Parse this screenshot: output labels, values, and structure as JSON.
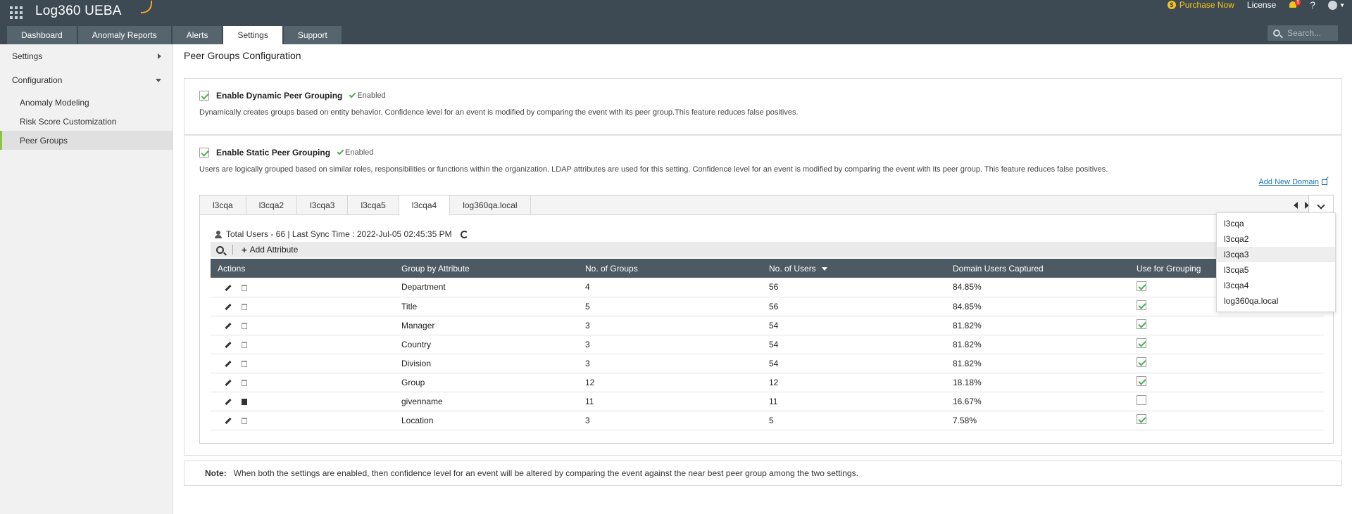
{
  "app": {
    "logo_text": "Log360 UEBA",
    "purchase_label": "Purchase Now",
    "license_label": "License",
    "alert_count": "5",
    "help_label": "?"
  },
  "nav": {
    "tabs": [
      {
        "label": "Dashboard"
      },
      {
        "label": "Anomaly Reports"
      },
      {
        "label": "Alerts"
      },
      {
        "label": "Settings"
      },
      {
        "label": "Support"
      }
    ],
    "active_tab": "Settings",
    "search_placeholder": "Search..."
  },
  "sidebar": {
    "settings_label": "Settings",
    "configuration_label": "Configuration",
    "items": [
      {
        "label": "Anomaly Modeling"
      },
      {
        "label": "Risk Score Customization"
      },
      {
        "label": "Peer Groups"
      }
    ],
    "active_item": "Peer Groups"
  },
  "page": {
    "title": "Peer Groups Configuration",
    "dynamic": {
      "label": "Enable Dynamic Peer Grouping",
      "status": "Enabled",
      "description": "Dynamically creates groups based on entity behavior. Confidence level for an event is modified by comparing the event with its peer group.This feature reduces false positives."
    },
    "static": {
      "label": "Enable Static Peer Grouping",
      "status": "Enabled",
      "description": "Users are logically grouped based on similar roles, responsibilities or functions within the organization. LDAP attributes are used for this setting. Confidence level for an event is modified by comparing the event with its peer group. This feature reduces false positives."
    },
    "add_domain_label": "Add New Domain",
    "domain_tabs": [
      "l3cqa",
      "l3cqa2",
      "l3cqa3",
      "l3cqa5",
      "l3cqa4",
      "log360qa.local"
    ],
    "active_domain": "l3cqa4",
    "sync_info": "Total Users - 66 | Last Sync Time : 2022-Jul-05 02:45:35 PM",
    "add_attribute_label": "Add Attribute",
    "table": {
      "headers": {
        "actions": "Actions",
        "group_by": "Group by Attribute",
        "num_groups": "No. of Groups",
        "num_users": "No. of Users",
        "domain_captured": "Domain Users Captured",
        "use_for_grouping": "Use for Grouping"
      },
      "rows": [
        {
          "attribute": "Department",
          "groups": "4",
          "users": "56",
          "captured": "84.85%",
          "use": true
        },
        {
          "attribute": "Title",
          "groups": "5",
          "users": "56",
          "captured": "84.85%",
          "use": true
        },
        {
          "attribute": "Manager",
          "groups": "3",
          "users": "54",
          "captured": "81.82%",
          "use": true
        },
        {
          "attribute": "Country",
          "groups": "3",
          "users": "54",
          "captured": "81.82%",
          "use": true
        },
        {
          "attribute": "Division",
          "groups": "3",
          "users": "54",
          "captured": "81.82%",
          "use": true
        },
        {
          "attribute": "Group",
          "groups": "12",
          "users": "12",
          "captured": "18.18%",
          "use": true
        },
        {
          "attribute": "givenname",
          "groups": "11",
          "users": "11",
          "captured": "16.67%",
          "use": false
        },
        {
          "attribute": "Location",
          "groups": "3",
          "users": "5",
          "captured": "7.58%",
          "use": true
        }
      ]
    },
    "domain_dropdown": [
      "l3cqa",
      "l3cqa2",
      "l3cqa3",
      "l3cqa5",
      "l3cqa4",
      "log360qa.local"
    ],
    "dropdown_highlight": "l3cqa3",
    "note_label": "Note:",
    "note_text": "When both the settings are enabled, then confidence level for an event will be altered by comparing the event against the near best peer group among the two settings."
  },
  "colors": {
    "header_bg": "#3d4a54",
    "accent_green": "#8bc34a",
    "link_blue": "#1a73b5",
    "purchase_yellow": "#f5c518"
  }
}
